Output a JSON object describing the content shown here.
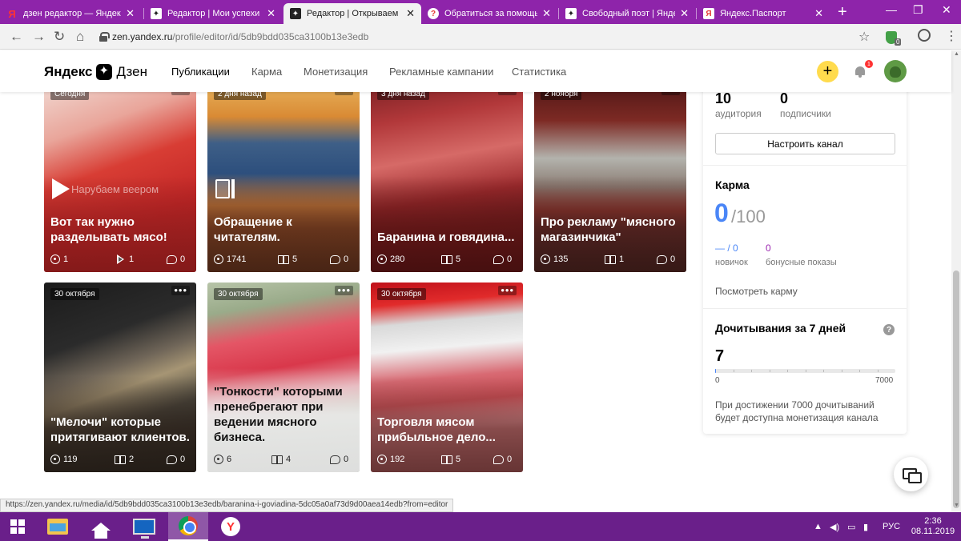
{
  "browser": {
    "tabs": [
      {
        "label": "дзен редактор — Яндекс",
        "favicon": "yandex-icon",
        "active": false
      },
      {
        "label": "Редактор | Мои успехи и",
        "favicon": "zen-icon",
        "active": false
      },
      {
        "label": "Редактор | Открываем",
        "favicon": "zen-icon",
        "active": true
      },
      {
        "label": "Обратиться за помощь",
        "favicon": "help-icon",
        "active": false
      },
      {
        "label": "Свободный поэт | Яндек",
        "favicon": "zen-icon",
        "active": false
      },
      {
        "label": "Яндекс.Паспорт",
        "favicon": "passport-icon",
        "active": false
      }
    ],
    "new_tab": "+",
    "window_controls": [
      "—",
      "❐",
      "✕"
    ],
    "url_host": "zen.yandex.ru",
    "url_path": "/profile/editor/id/5db9bdd035ca3100b13e3edb",
    "extension_badge": "0",
    "status_url": "https://zen.yandex.ru/media/id/5db9bdd035ca3100b13e3edb/baranina-i-goviadina-5dc05a0af73d9d00aea14edb?from=editor"
  },
  "header": {
    "logo_left": "Яндекс",
    "logo_right": "Дзен",
    "nav": [
      {
        "label": "Публикации",
        "active": true
      },
      {
        "label": "Карма",
        "active": false
      },
      {
        "label": "Монетизация",
        "active": false
      },
      {
        "label": "Рекламные кампании",
        "active": false
      },
      {
        "label": "Статистика",
        "active": false
      }
    ],
    "plus": "+",
    "notifications_count": "1"
  },
  "cards": [
    {
      "date": "Сегодня",
      "title": "Вот так нужно разделывать мясо!",
      "type": "video",
      "overlay": "Нарубаем веером",
      "views": "1",
      "plays": "1",
      "comments": "0"
    },
    {
      "date": "2 дня назад",
      "title": "Обращение к читателям.",
      "type": "narrative",
      "views": "1741",
      "reads": "5",
      "comments": "0"
    },
    {
      "date": "3 дня назад",
      "title": "Баранина и говядина...",
      "type": "article",
      "views": "280",
      "reads": "5",
      "comments": "0"
    },
    {
      "date": "2 ноября",
      "title": "Про рекламу \"мясного магазинчика\"",
      "type": "article",
      "views": "135",
      "reads": "1",
      "comments": "0"
    },
    {
      "date": "30 октября",
      "title": "\"Мелочи\" которые притягивают клиентов.",
      "type": "article",
      "views": "119",
      "reads": "2",
      "comments": "0"
    },
    {
      "date": "30 октября",
      "title": "\"Тонкости\" которыми пренебрегают при ведении мясного бизнеса.",
      "type": "article",
      "views": "6",
      "reads": "4",
      "comments": "0"
    },
    {
      "date": "30 октября",
      "title": "Торговля мясом прибыльное дело...",
      "type": "article",
      "views": "192",
      "reads": "5",
      "comments": "0"
    }
  ],
  "card_more": "•••",
  "sidebar": {
    "audience_value": "10",
    "audience_label": "аудитория",
    "subscribers_value": "0",
    "subscribers_label": "подписчики",
    "configure_button": "Настроить канал",
    "karma_title": "Карма",
    "karma_value": "0",
    "karma_max": "/100",
    "karma_stat1_value": "— / 0",
    "karma_stat1_label": "новичок",
    "karma_stat2_value": "0",
    "karma_stat2_label": "бонусные показы",
    "karma_link": "Посмотреть карму",
    "reads_title": "Дочитывания за 7 дней",
    "reads_help": "?",
    "reads_value": "7",
    "reads_min": "0",
    "reads_max": "7000",
    "reads_progress_fraction": 0.001,
    "reads_note": "При достижении 7000 дочитываний будет доступна монетизация канала"
  },
  "taskbar": {
    "language": "РУС",
    "time": "2:36",
    "date": "08.11.2019"
  },
  "colors": {
    "browser_purple": "#8e24aa",
    "taskbar_purple": "#6a1f8a",
    "karma_blue": "#4a86f7",
    "bonus_purple": "#9c27b0",
    "plus_yellow": "#ffdb4d"
  }
}
